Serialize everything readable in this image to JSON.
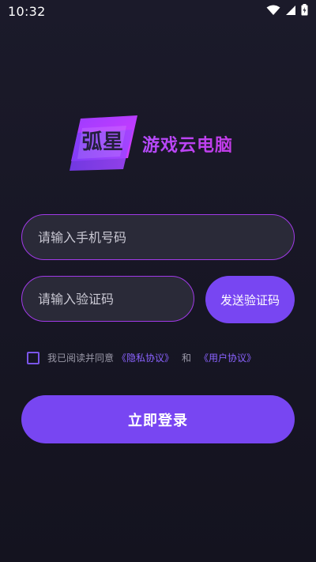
{
  "status_bar": {
    "time": "10:32",
    "icons": [
      "wifi-icon",
      "cellular-signal-icon",
      "battery-icon"
    ]
  },
  "logo": {
    "badge_text": "弧星",
    "title": "游戏云电脑"
  },
  "form": {
    "phone_placeholder": "请输入手机号码",
    "code_placeholder": "请输入验证码",
    "send_code_label": "发送验证码"
  },
  "agreement": {
    "prefix": "我已阅读并同意",
    "privacy_link": "《隐私协议》",
    "and_text": "和",
    "user_link": "《用户协议》",
    "checked": false
  },
  "login_button_label": "立即登录",
  "colors": {
    "accent": "#7846f2",
    "border": "#a13ae8",
    "link": "#8a63ff",
    "logo_gradient_start": "#9b3bff",
    "logo_gradient_end": "#d83dff"
  }
}
